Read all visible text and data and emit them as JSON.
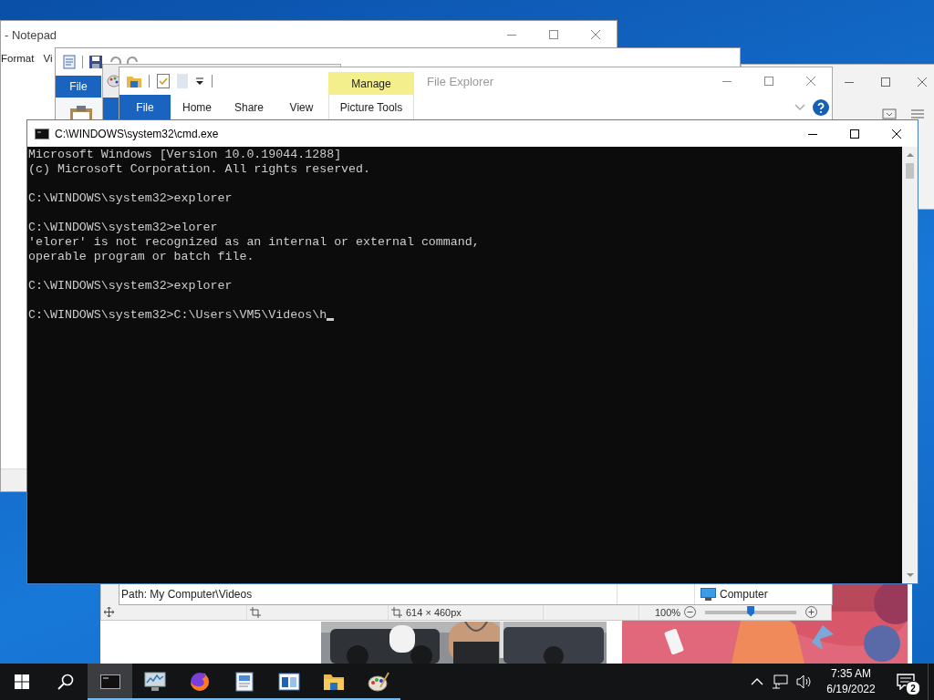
{
  "notepad": {
    "title": "- Notepad",
    "menu": [
      "Format",
      "Vi"
    ]
  },
  "wordpad": {
    "tabs": [
      {
        "label": "File",
        "selected": true
      }
    ]
  },
  "explorer": {
    "title": "File Explorer",
    "context_tab": "Manage",
    "tabs": [
      {
        "label": "File",
        "selected": true
      },
      {
        "label": "Home",
        "selected": false
      },
      {
        "label": "Share",
        "selected": false
      },
      {
        "label": "View",
        "selected": false
      },
      {
        "label": "Picture Tools",
        "selected": false
      }
    ],
    "status": {
      "path": "Path: My Computer\\Videos",
      "location": "Computer"
    }
  },
  "cmd": {
    "title": "C:\\WINDOWS\\system32\\cmd.exe",
    "cursor": true,
    "blocks": [
      [
        "Microsoft Windows [Version 10.0.19044.1288]",
        "(c) Microsoft Corporation. All rights reserved."
      ],
      [
        "C:\\WINDOWS\\system32>explorer"
      ],
      [
        "C:\\WINDOWS\\system32>elorer",
        "'elorer' is not recognized as an internal or external command,",
        "operable program or batch file."
      ],
      [
        "C:\\WINDOWS\\system32>explorer"
      ],
      [
        "C:\\WINDOWS\\system32>C:\\Users\\VM5\\Videos\\h"
      ]
    ]
  },
  "viewer": {
    "dimensions": "614 × 460px",
    "zoom": "100%",
    "zoom_slider": {
      "level": 0.5
    }
  },
  "taskbar": {
    "apps": [
      {
        "kind": "terminal",
        "selected": true,
        "running": true
      },
      {
        "kind": "monitor",
        "selected": false,
        "running": true
      },
      {
        "kind": "browser",
        "selected": false,
        "running": true
      },
      {
        "kind": "document",
        "selected": false,
        "running": true
      },
      {
        "kind": "window",
        "selected": false,
        "running": true
      },
      {
        "kind": "folder",
        "selected": false,
        "running": true
      },
      {
        "kind": "palette",
        "selected": false,
        "running": true
      }
    ],
    "time": "7:35 AM",
    "date": "6/19/2022",
    "notifications": "2"
  }
}
